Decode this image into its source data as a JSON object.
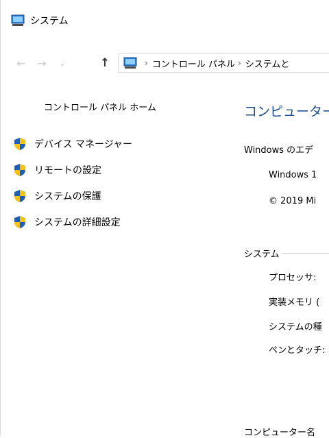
{
  "window": {
    "title": "システム"
  },
  "nav": {
    "back": "←",
    "forward": "→",
    "recent": "⌄",
    "up": "↑",
    "breadcrumb": [
      "コントロール パネル",
      "システムと"
    ]
  },
  "left_pane": {
    "home": "コントロール パネル ホーム",
    "tasks": [
      {
        "label": "デバイス マネージャー"
      },
      {
        "label": "リモートの設定"
      },
      {
        "label": "システムの保護"
      },
      {
        "label": "システムの詳細設定"
      }
    ]
  },
  "main": {
    "heading": "コンピューター",
    "edition_label": "Windows のエデ",
    "edition_name": "Windows 1",
    "copyright": "© 2019 Mi",
    "system_section": "システム",
    "system_rows": [
      "プロセッサ:",
      "実装メモリ (",
      "システムの種",
      "ペンとタッチ:"
    ],
    "computer_name_label": "コンピューター名"
  },
  "colors": {
    "link": "#1e4e8c",
    "shield_blue": "#1f5fb4",
    "shield_yellow": "#f4c21a"
  }
}
